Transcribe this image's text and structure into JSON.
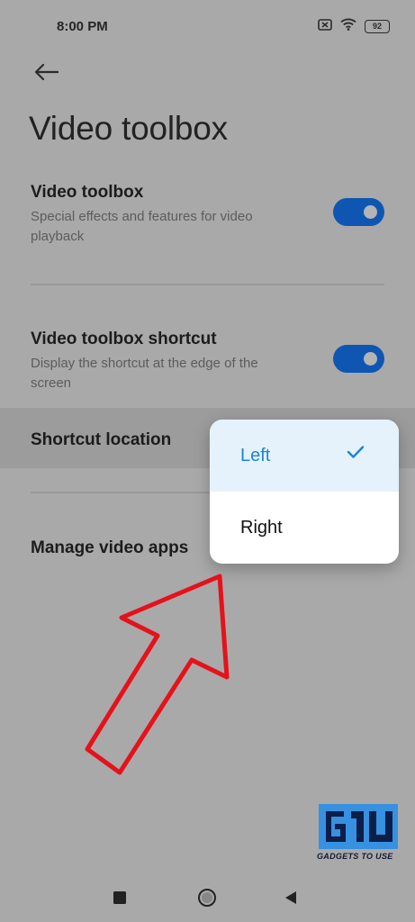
{
  "status_bar": {
    "time": "8:00 PM",
    "battery": "92",
    "icons": [
      "sim-error-icon",
      "wifi-icon",
      "battery-icon"
    ]
  },
  "header": {
    "back_icon": "back-arrow-icon",
    "title": "Video toolbox"
  },
  "settings": {
    "video_toolbox": {
      "title": "Video toolbox",
      "subtitle": "Special effects and features for video playback",
      "toggle_on": true
    },
    "shortcut": {
      "title": "Video toolbox shortcut",
      "subtitle": "Display the shortcut at the edge of the screen",
      "toggle_on": true
    },
    "shortcut_location": {
      "title": "Shortcut location"
    },
    "manage_apps": {
      "title": "Manage video apps"
    }
  },
  "popup": {
    "options": [
      {
        "label": "Left",
        "selected": true
      },
      {
        "label": "Right",
        "selected": false
      }
    ]
  },
  "annotation": {
    "shape": "arrow-outline-icon",
    "color": "#e5121b"
  },
  "watermark": {
    "logo": "G1U",
    "text": "GADGETS TO USE"
  },
  "colors": {
    "accent": "#1c84d9",
    "toggle": "#0f56b3",
    "background": "#a9a9a9"
  },
  "nav_bar": {
    "icons": [
      "recent-apps-icon",
      "home-icon",
      "back-triangle-icon"
    ]
  }
}
